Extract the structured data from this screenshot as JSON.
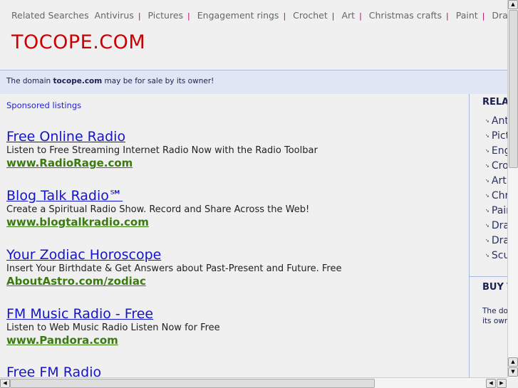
{
  "topbar": {
    "label": "Related Searches",
    "links": [
      "Antivirus",
      "Pictures",
      "Engagement rings",
      "Crochet",
      "Art",
      "Christmas crafts",
      "Paint",
      "Draft craft suppl"
    ]
  },
  "logo": "TOCOPE.COM",
  "sale": {
    "pre": "The domain ",
    "domain": "tocope.com",
    "post": " may be for sale by its owner!"
  },
  "sponsored": "Sponsored listings",
  "ads": [
    {
      "title": "Free Online Radio",
      "desc": "Listen to Free Streaming Internet Radio Now with the Radio Toolbar",
      "url": "www.RadioRage.com"
    },
    {
      "title": "Blog Talk Radio℠",
      "desc": "Create a Spiritual Radio Show. Record and Share Across the Web!",
      "url": "www.blogtalkradio.com"
    },
    {
      "title": "Your Zodiac Horoscope",
      "desc": "Insert Your Birthdate & Get Answers about Past-Present and Future. Free",
      "url": "AboutAstro.com/zodiac"
    },
    {
      "title": "FM Music Radio - Free",
      "desc": "Listen to Web Music Radio Listen Now for Free",
      "url": "www.Pandora.com"
    },
    {
      "title": "Free FM Radio",
      "desc": "",
      "url": ""
    }
  ],
  "sidebar": {
    "heading": "RELA",
    "items": [
      "Antivirus",
      "Pictures",
      "Engagement rings",
      "Crochet",
      "Art",
      "Christmas crafts",
      "Paint",
      "Draft craft suppl",
      "Dra",
      "Scu"
    ],
    "buy_heading": "BUY T",
    "buy_text_1": "The do",
    "buy_text_2": "its owr"
  }
}
